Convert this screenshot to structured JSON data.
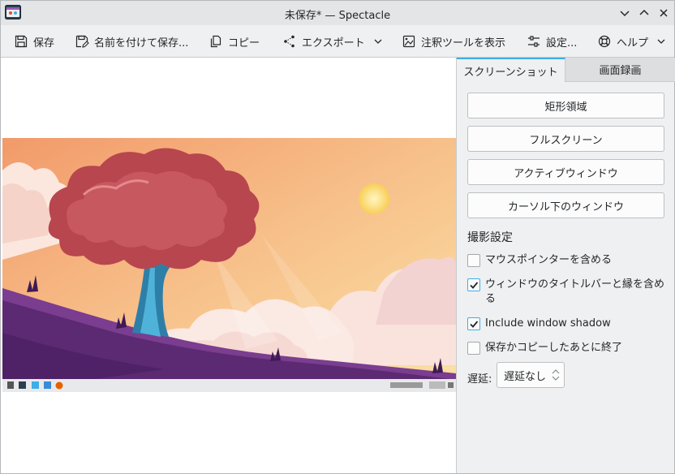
{
  "window": {
    "title": "未保存* — Spectacle"
  },
  "toolbar": {
    "save": "保存",
    "save_as": "名前を付けて保存...",
    "copy": "コピー",
    "export": "エクスポート",
    "annotate": "注釈ツールを表示",
    "settings": "設定...",
    "help": "ヘルプ"
  },
  "tabs": {
    "screenshot": "スクリーンショット",
    "recording": "画面録画"
  },
  "modes": {
    "rectangular": "矩形領域",
    "fullscreen": "フルスクリーン",
    "active_window": "アクティブウィンドウ",
    "window_under_cursor": "カーソル下のウィンドウ"
  },
  "options": {
    "title": "撮影設定",
    "include_pointer": {
      "label": "マウスポインターを含める",
      "checked": false
    },
    "include_titlebar": {
      "label": "ウィンドウのタイトルバーと縁を含める",
      "checked": true
    },
    "include_shadow": {
      "label": "Include window shadow",
      "checked": true
    },
    "quit_after": {
      "label": "保存かコピーしたあとに終了",
      "checked": false
    }
  },
  "delay": {
    "label": "遅延:",
    "value": "遅延なし"
  },
  "colors": {
    "accent": "#3daee9",
    "panel_bg": "#eff0f1",
    "preview_bg": "#ffffff"
  }
}
